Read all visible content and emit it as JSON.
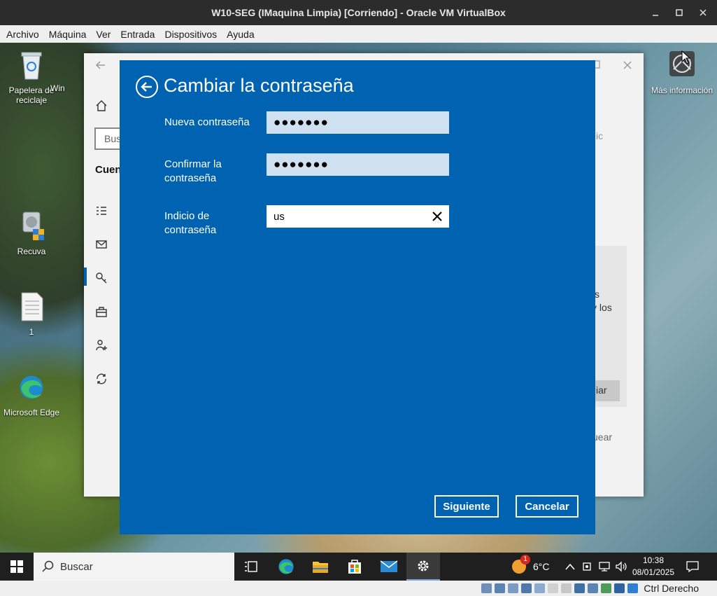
{
  "host": {
    "title": "W10-SEG (IMaquina Limpia) [Corriendo] - Oracle VM VirtualBox",
    "menu": [
      "Archivo",
      "Máquina",
      "Ver",
      "Entrada",
      "Dispositivos",
      "Ayuda"
    ],
    "status_key": "Ctrl Derecho"
  },
  "desktop": {
    "icons": {
      "recycle": "Papelera de reciclaje",
      "partial": "Win",
      "recuva": "Recuva",
      "file": "1",
      "edge": "Microsoft Edge",
      "more_info": "Más información"
    }
  },
  "settings_bg": {
    "search_placeholder": "Bus",
    "section": "Cuent",
    "frag_ic": "ic",
    "frag_s": "s",
    "frag_los": "y los",
    "frag_iar": "iar",
    "frag_uear": "uear"
  },
  "dialog": {
    "title": "Cambiar la contraseña",
    "new_password_label": "Nueva contraseña",
    "new_password_value": "●●●●●●●",
    "confirm_label": "Confirmar la contraseña",
    "confirm_value": "●●●●●●●",
    "hint_label": "Indicio de contraseña",
    "hint_value": "us",
    "next_button": "Siguiente",
    "cancel_button": "Cancelar"
  },
  "taskbar": {
    "search_placeholder": "Buscar",
    "weather_badge": "1",
    "temperature": "6°C",
    "time": "10:38",
    "date": "08/01/2025"
  },
  "colors": {
    "dialog_bg": "#0063b1",
    "field_bg": "#cfe0f0",
    "taskbar_bg": "#1f1f1f"
  }
}
